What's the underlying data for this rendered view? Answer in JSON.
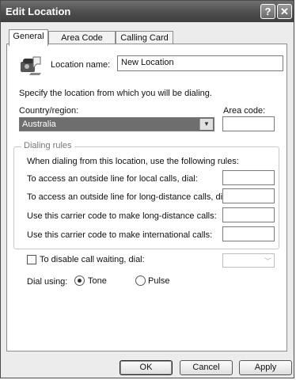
{
  "window": {
    "title": "Edit Location",
    "help_label": "?",
    "close_label": "✕"
  },
  "tabs": [
    {
      "label": "General",
      "active": true
    },
    {
      "label": "Area Code Rules",
      "active": false
    },
    {
      "label": "Calling Card",
      "active": false
    }
  ],
  "general": {
    "location_icon": "phone-location-icon",
    "location_name_label": "Location name:",
    "location_name_value": "New Location",
    "specify_text": "Specify the location from which you will be dialing.",
    "country_label": "Country/region:",
    "country_value": "Australia",
    "area_code_label": "Area code:",
    "area_code_value": "",
    "dialing_rules": {
      "legend": "Dialing rules",
      "intro": "When dialing from this location, use the following rules:",
      "local_label": "To access an outside line for local calls, dial:",
      "local_value": "",
      "long_distance_label": "To access an outside line for long-distance calls, dial:",
      "long_distance_value": "",
      "carrier_long_label": "Use this carrier code to make long-distance calls:",
      "carrier_long_value": "",
      "carrier_intl_label": "Use this carrier code to make international calls:",
      "carrier_intl_value": ""
    },
    "call_waiting_label": "To disable call waiting, dial:",
    "call_waiting_checked": false,
    "dial_using_label": "Dial using:",
    "tone_label": "Tone",
    "pulse_label": "Pulse",
    "selected_dial_mode": "Tone"
  },
  "buttons": {
    "ok": "OK",
    "cancel": "Cancel",
    "apply": "Apply"
  }
}
